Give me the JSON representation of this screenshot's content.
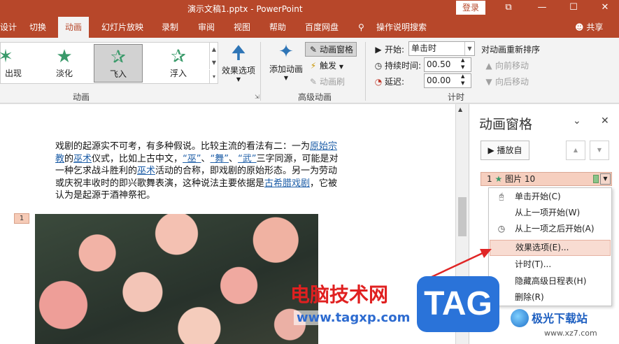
{
  "window": {
    "title": "演示文稿1.pptx  -  PowerPoint",
    "signin": "登录",
    "buttons": {
      "restore": "⧉",
      "minimize": "—",
      "maximize": "☐",
      "close": "✕"
    }
  },
  "tabs": [
    {
      "label": "设计"
    },
    {
      "label": "切换"
    },
    {
      "label": "动画",
      "active": true
    },
    {
      "label": "幻灯片放映"
    },
    {
      "label": "录制"
    },
    {
      "label": "审阅"
    },
    {
      "label": "视图"
    },
    {
      "label": "帮助"
    },
    {
      "label": "百度网盘"
    },
    {
      "label": "操作说明搜索"
    }
  ],
  "share": "共享",
  "ribbon": {
    "animation_gallery": [
      {
        "label": "出现"
      },
      {
        "label": "淡化"
      },
      {
        "label": "飞入",
        "selected": true
      },
      {
        "label": "浮入"
      }
    ],
    "effect_options": "效果选项",
    "group_animation": "动画",
    "add_animation": "添加动画",
    "animation_pane": "动画窗格",
    "trigger": "触发",
    "animation_painter": "动画刷",
    "group_advanced": "高级动画",
    "start_label": "开始:",
    "start_value": "单击时",
    "duration_label": "持续时间:",
    "duration_value": "00.50",
    "delay_label": "延迟:",
    "delay_value": "00.00",
    "group_timing": "计时",
    "reorder_title": "对动画重新排序",
    "move_earlier": "向前移动",
    "move_later": "向后移动"
  },
  "slide": {
    "text_segments": [
      {
        "t": "戏剧的起源实不可考，有多种假说。比较主流的看法有二：一为"
      },
      {
        "t": "原始宗教",
        "link": true
      },
      {
        "t": "的"
      },
      {
        "t": "巫术",
        "link": true
      },
      {
        "t": "仪式，比如上古中文，"
      },
      {
        "t": "“巫”",
        "link": true
      },
      {
        "t": "、"
      },
      {
        "t": "“舞”",
        "link": true
      },
      {
        "t": "、"
      },
      {
        "t": "“武”",
        "link": true
      },
      {
        "t": "三字同源，可能是对一种乞求战斗胜利的"
      },
      {
        "t": "巫术",
        "link": true
      },
      {
        "t": "活动的合称，即戏剧的原始形态。另一为劳动或庆祝丰收时的即兴歌舞表演，这种说法主要依据是"
      },
      {
        "t": "古希腊戏剧",
        "link": true
      },
      {
        "t": "，它被认为是起源于酒神祭祀。"
      }
    ],
    "anim_tag": "1"
  },
  "pane": {
    "title": "动画窗格",
    "play_from": "播放自",
    "entry": {
      "index": "1",
      "name": "图片 10"
    }
  },
  "context_menu": [
    {
      "label": "单击开始(C)",
      "icon": "mouse-click-icon"
    },
    {
      "label": "从上一项开始(W)",
      "icon": ""
    },
    {
      "label": "从上一项之后开始(A)",
      "icon": "clock-icon"
    },
    {
      "label": "效果选项(E)...",
      "icon": "",
      "highlighted": true
    },
    {
      "label": "计时(T)...",
      "icon": ""
    },
    {
      "label": "隐藏高级日程表(H)",
      "icon": ""
    },
    {
      "label": "删除(R)",
      "icon": ""
    }
  ],
  "watermarks": {
    "cn_site": "电脑技术网",
    "url": "www.tagxp.com",
    "tag": "TAG",
    "jg_site": "极光下载站",
    "jg_url": "www.xz7.com"
  },
  "colors": {
    "accent": "#b7472a",
    "link": "#1f5fa8",
    "highlight": "#f8dcd2",
    "arrow": "#e02626"
  }
}
